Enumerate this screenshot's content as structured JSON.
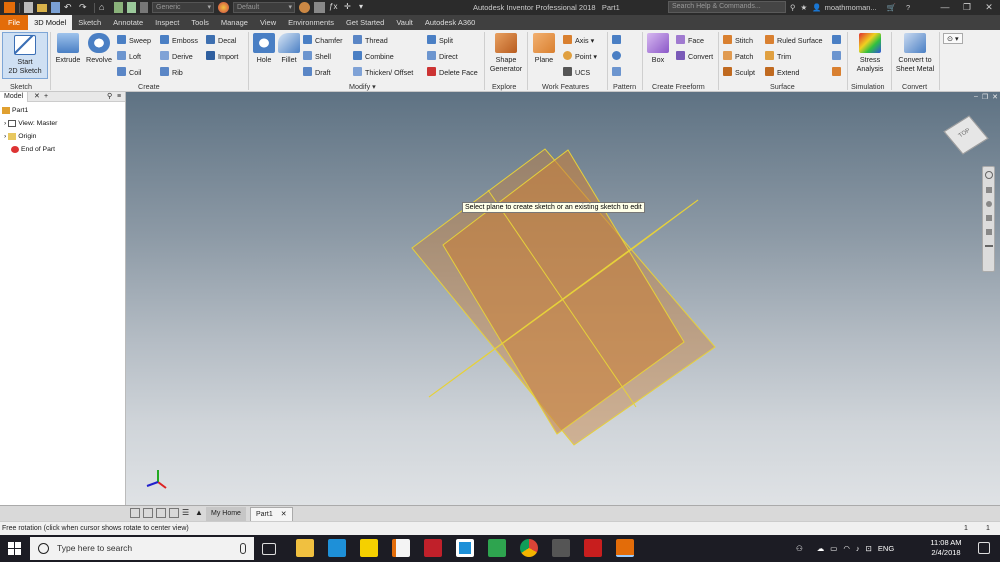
{
  "window": {
    "title": "Autodesk Inventor Professional 2018",
    "document": "Part1",
    "search_placeholder": "Search Help & Commands...",
    "username": "moathmoman...",
    "material_combo": "Generic",
    "appearance_combo": "Default",
    "controls": [
      "—",
      "❐",
      "✕"
    ]
  },
  "menu_tabs": [
    "File",
    "3D Model",
    "Sketch",
    "Annotate",
    "Inspect",
    "Tools",
    "Manage",
    "View",
    "Environments",
    "Get Started",
    "Vault",
    "Autodesk A360"
  ],
  "ribbon": {
    "sketch": {
      "start_2d_sketch": "Start\n2D Sketch",
      "label": "Sketch"
    },
    "create": {
      "extrude": "Extrude",
      "revolve": "Revolve",
      "sweep": "Sweep",
      "loft": "Loft",
      "coil": "Coil",
      "emboss": "Emboss",
      "derive": "Derive",
      "rib": "Rib",
      "decal": "Decal",
      "import": "Import",
      "label": "Create"
    },
    "modify": {
      "hole": "Hole",
      "fillet": "Fillet",
      "chamfer": "Chamfer",
      "shell": "Shell",
      "draft": "Draft",
      "thread": "Thread",
      "combine": "Combine",
      "thicken_offset": "Thicken/ Offset",
      "split": "Split",
      "direct": "Direct",
      "delete_face": "Delete Face",
      "label": "Modify ▾"
    },
    "explore": {
      "shape_generator": "Shape\nGenerator",
      "label": "Explore"
    },
    "work_features": {
      "plane": "Plane",
      "axis": "Axis",
      "point": "Point",
      "ucs": "UCS",
      "label": "Work Features"
    },
    "pattern": {
      "label": "Pattern"
    },
    "create_freeform": {
      "box": "Box",
      "face": "Face",
      "convert": "Convert",
      "label": "Create Freeform"
    },
    "surface": {
      "stitch": "Stitch",
      "patch": "Patch",
      "sculpt": "Sculpt",
      "ruled_surface": "Ruled Surface",
      "trim": "Trim",
      "extend": "Extend",
      "label": "Surface"
    },
    "simulation": {
      "stress_analysis": "Stress\nAnalysis",
      "label": "Simulation"
    },
    "convert": {
      "convert_to_sheet_metal": "Convert to\nSheet Metal",
      "label": "Convert"
    }
  },
  "browser": {
    "tab": "Model",
    "items": [
      "Part1",
      "View: Master",
      "Origin",
      "End of Part"
    ]
  },
  "viewport": {
    "tooltip": "Select plane to create sketch or an existing sketch to edit",
    "viewcube_label": "TOP",
    "plane_fill": "#c8813c",
    "plane_edge": "#e6d13a"
  },
  "doc_tabs": {
    "home": "My Home",
    "active": "Part1"
  },
  "status": {
    "message": "Free rotation (click when cursor shows rotate to center view)",
    "n1": "1",
    "n2": "1"
  },
  "taskbar": {
    "search_placeholder": "Type here to search",
    "language": "ENG",
    "time": "11:08 AM",
    "date": "2/4/2018"
  }
}
